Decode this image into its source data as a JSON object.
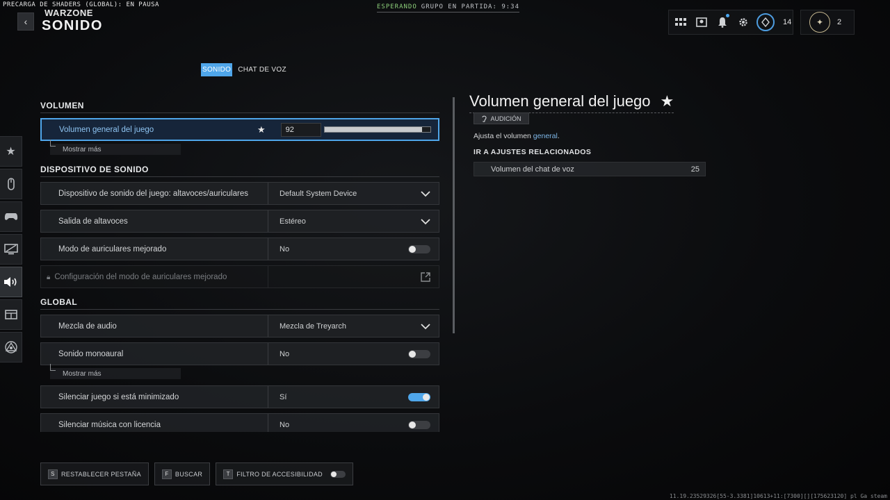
{
  "header": {
    "shader_status": "PRECARGA DE SHADERS (GLOBAL): EN PAUSA",
    "game_title": "WARZONE",
    "page_title": "SONIDO",
    "back_icon": "chevron-left-icon",
    "party_waiting": "ESPERANDO",
    "party_group": "GRUPO EN PARTIDA: 9:34",
    "level": "14",
    "prestige": "2"
  },
  "tabs": [
    {
      "label": "SONIDO",
      "active": true
    },
    {
      "label": "CHAT DE VOZ",
      "active": false
    }
  ],
  "rail": [
    "star-icon",
    "controller-mouse-icon",
    "gamepad-icon",
    "monitor-icon",
    "speaker-icon",
    "interface-icon",
    "network-icon"
  ],
  "sections": {
    "volume": "VOLUMEN",
    "device": "DISPOSITIVO DE SONIDO",
    "global": "GLOBAL"
  },
  "settings": {
    "master_volume": {
      "label": "Volumen general del juego",
      "value": "92",
      "level": 0.92
    },
    "show_more": "Mostrar más",
    "device": {
      "label": "Dispositivo de sonido del juego: altavoces/auriculares",
      "value": "Default System Device"
    },
    "speaker_output": {
      "label": "Salida de altavoces",
      "value": "Estéreo"
    },
    "headphone_mode": {
      "label": "Modo de auriculares mejorado",
      "value": "No"
    },
    "headphone_config": {
      "label": "Configuración del modo de auriculares mejorado"
    },
    "audio_mix": {
      "label": "Mezcla de audio",
      "value": "Mezcla de Treyarch"
    },
    "mono": {
      "label": "Sonido monoaural",
      "value": "No"
    },
    "mute_minimized": {
      "label": "Silenciar juego si está minimizado",
      "value": "Sí"
    },
    "mute_licensed": {
      "label": "Silenciar música con licencia",
      "value": "No"
    }
  },
  "detail": {
    "title": "Volumen general del juego",
    "tag": "AUDICIÓN",
    "desc_prefix": "Ajusta el volumen ",
    "desc_highlight": "general",
    "desc_suffix": ".",
    "related_heading": "IR A AJUSTES RELACIONADOS",
    "related_label": "Volumen del chat de voz",
    "related_value": "25"
  },
  "bottom": {
    "reset_key": "S",
    "reset_label": "RESTABLECER PESTAÑA",
    "search_key": "F",
    "search_label": "BUSCAR",
    "filter_key": "T",
    "filter_label": "FILTRO DE ACCESIBILIDAD"
  },
  "build_info": "11.19.23529326[55-3.3381]10613+11:[7300][][175623120] pl Ga steam",
  "colors": {
    "accent": "#4fa6ea",
    "party_green": "#8ccf7a"
  }
}
